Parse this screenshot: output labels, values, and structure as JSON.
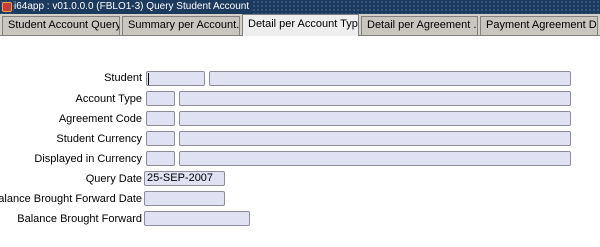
{
  "window": {
    "title": "i64app : v01.0.0.0 (FBLO1-3) Query Student Account"
  },
  "tabs": [
    {
      "label": "Student Account Query *"
    },
    {
      "label": "Summary per Account..."
    },
    {
      "label": "Detail per Account Type"
    },
    {
      "label": "Detail per Agreement ..."
    },
    {
      "label": "Payment Agreement D..."
    }
  ],
  "form": {
    "student_label": "Student",
    "account_type_label": "Account Type",
    "agreement_code_label": "Agreement Code",
    "student_currency_label": "Student Currency",
    "displayed_currency_label": "Displayed in Currency",
    "query_date_label": "Query Date",
    "query_date_value": "25-SEP-2007",
    "bbf_date_label": "Balance Brought Forward Date",
    "bbf_label": "Balance Brought Forward"
  },
  "colors": {
    "titlebar": "#1c3a5e",
    "field_bg": "#e0e2f4",
    "tab_bg": "#d4d0c8"
  }
}
